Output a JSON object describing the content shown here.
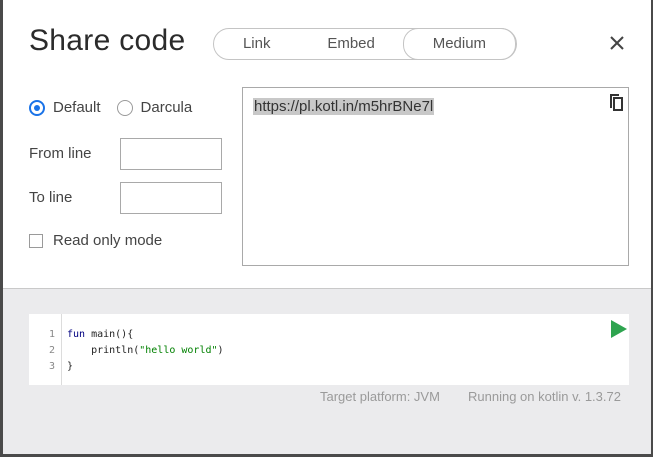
{
  "dialog": {
    "title": "Share code",
    "tabs": [
      {
        "label": "Link"
      },
      {
        "label": "Embed"
      },
      {
        "label": "Medium",
        "selected": true
      }
    ]
  },
  "options": {
    "themes": [
      {
        "label": "Default",
        "selected": true
      },
      {
        "label": "Darcula",
        "selected": false
      }
    ],
    "from_line": {
      "label": "From line",
      "value": ""
    },
    "to_line": {
      "label": "To line",
      "value": ""
    },
    "read_only": {
      "label": "Read only mode",
      "checked": false
    }
  },
  "share": {
    "url": "https://pl.kotl.in/m5hrBNe7l"
  },
  "editor": {
    "line_numbers": [
      "1",
      "2",
      "3"
    ],
    "code": {
      "l1_kw": "fun",
      "l1_rest": " main(){",
      "l2_indent": "    println(",
      "l2_str": "\"hello world\"",
      "l2_end": ")",
      "l3": "}"
    }
  },
  "footer": {
    "platform": "Target platform: JVM",
    "version": "Running on kotlin v. 1.3.72"
  },
  "colors": {
    "accent": "#1a73e8",
    "run_green": "#2ea44f"
  }
}
